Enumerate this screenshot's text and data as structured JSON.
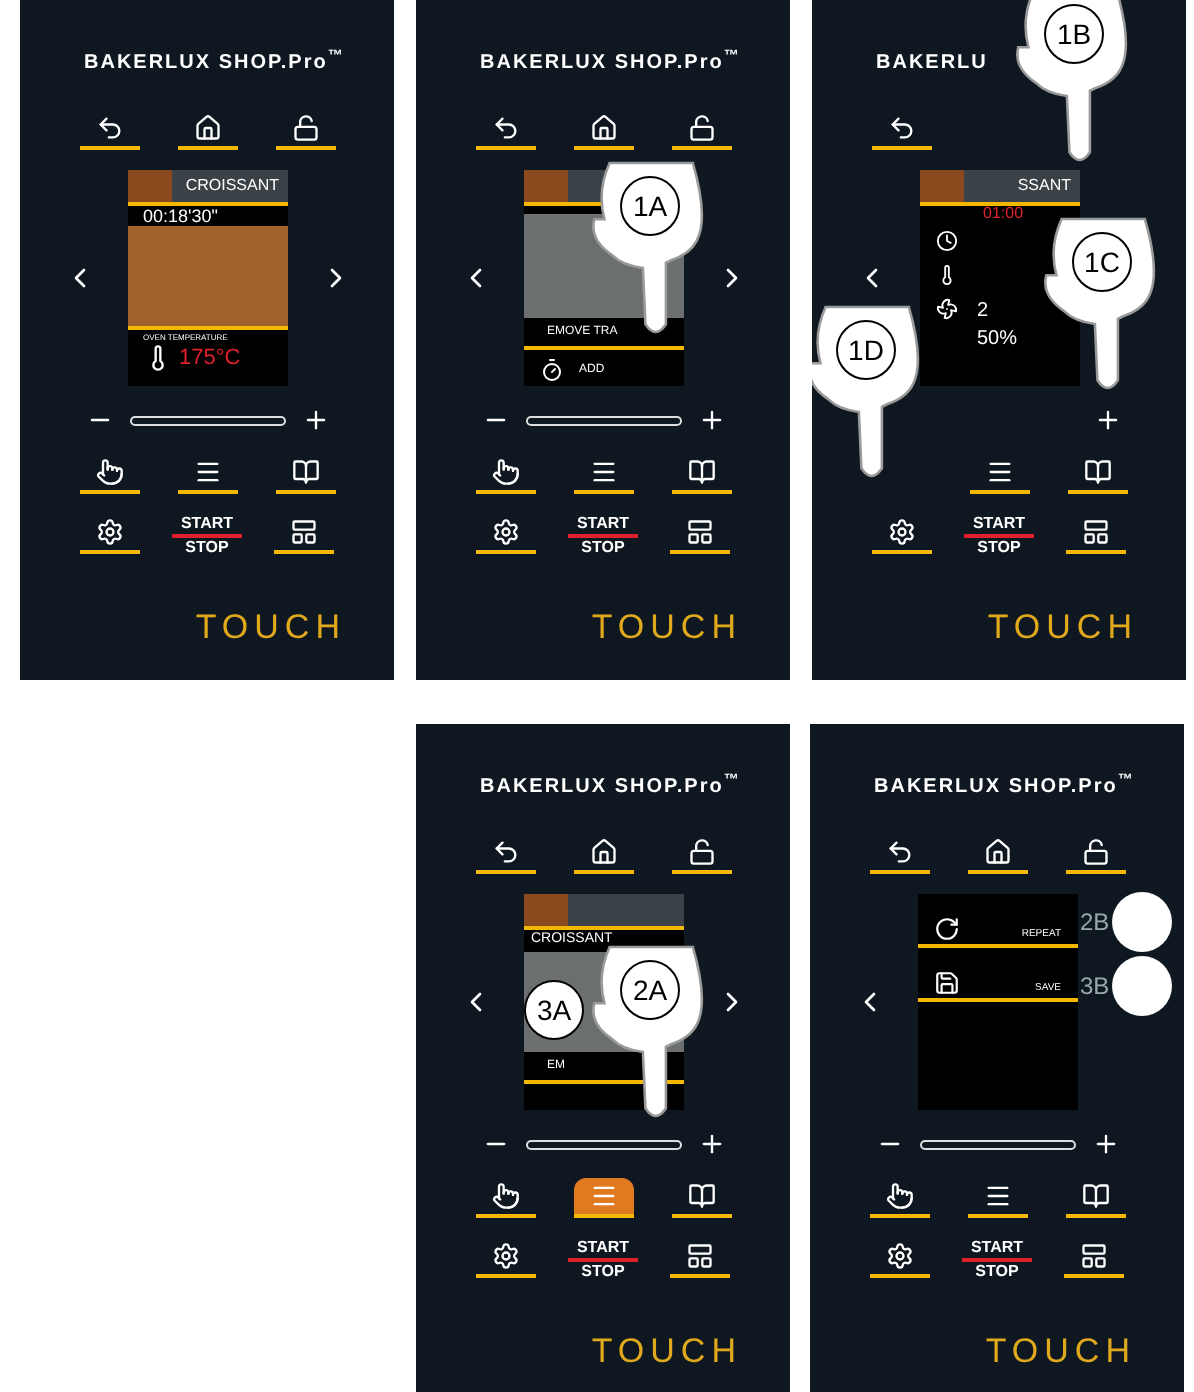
{
  "panels": [
    {
      "brand": "BAKERLUX SHOP.Pro$^{™}$",
      "next": true,
      "pressed": false,
      "start": "START",
      "stop": "STOP",
      "logo": "TOUCH",
      "screen": {
        "kind": "cooking",
        "title": "CROISSANT",
        "timer": "00:18'30\"",
        "temp_label": "OVEN TEMPERATURE",
        "temperature": "175°C"
      }
    },
    {
      "brand": "BAKERLUX SHOP.Pro$^{™}$",
      "next": true,
      "pressed": false,
      "start": "START",
      "stop": "STOP",
      "logo": "TOUCH",
      "screen": {
        "kind": "remove",
        "message": "EMOVE TRA",
        "action": "ADD"
      },
      "callouts": [
        {
          "kind": "hand",
          "label": "1A"
        }
      ]
    },
    {
      "brand": "BAKERLU",
      "pressed": false,
      "start": "START",
      "stop": "STOP",
      "logo": "TOUCH",
      "screen": {
        "kind": "settings",
        "title": "SSANT",
        "time": "01:00",
        "values": [
          "2",
          "50%"
        ]
      },
      "callouts": [
        {
          "kind": "hand",
          "label": "1B"
        },
        {
          "kind": "hand",
          "label": "1C"
        },
        {
          "kind": "hand",
          "label": "1D"
        }
      ]
    },
    {
      "brand": "BAKERLUX SHOP.Pro$^{™}$",
      "next": true,
      "pressed": true,
      "start": "START",
      "stop": "STOP",
      "logo": "TOUCH",
      "screen": {
        "kind": "photo",
        "title": "CROISSANT",
        "message": "EM"
      },
      "callouts": [
        {
          "kind": "hand",
          "label": "2A"
        },
        {
          "kind": "circle",
          "label": "3A"
        }
      ]
    },
    {
      "brand": "BAKERLUX SHOP.Pro$^{™}$",
      "next": false,
      "pressed": false,
      "start": "START",
      "stop": "STOP",
      "logo": "TOUCH",
      "screen": {
        "kind": "menu",
        "items": [
          {
            "kind": "repeat",
            "label": "REPEAT"
          },
          {
            "kind": "save",
            "label": "SAVE"
          }
        ]
      },
      "callouts": [
        {
          "kind": "dot",
          "label": "2B"
        },
        {
          "kind": "dot",
          "label": "3B"
        }
      ]
    }
  ]
}
